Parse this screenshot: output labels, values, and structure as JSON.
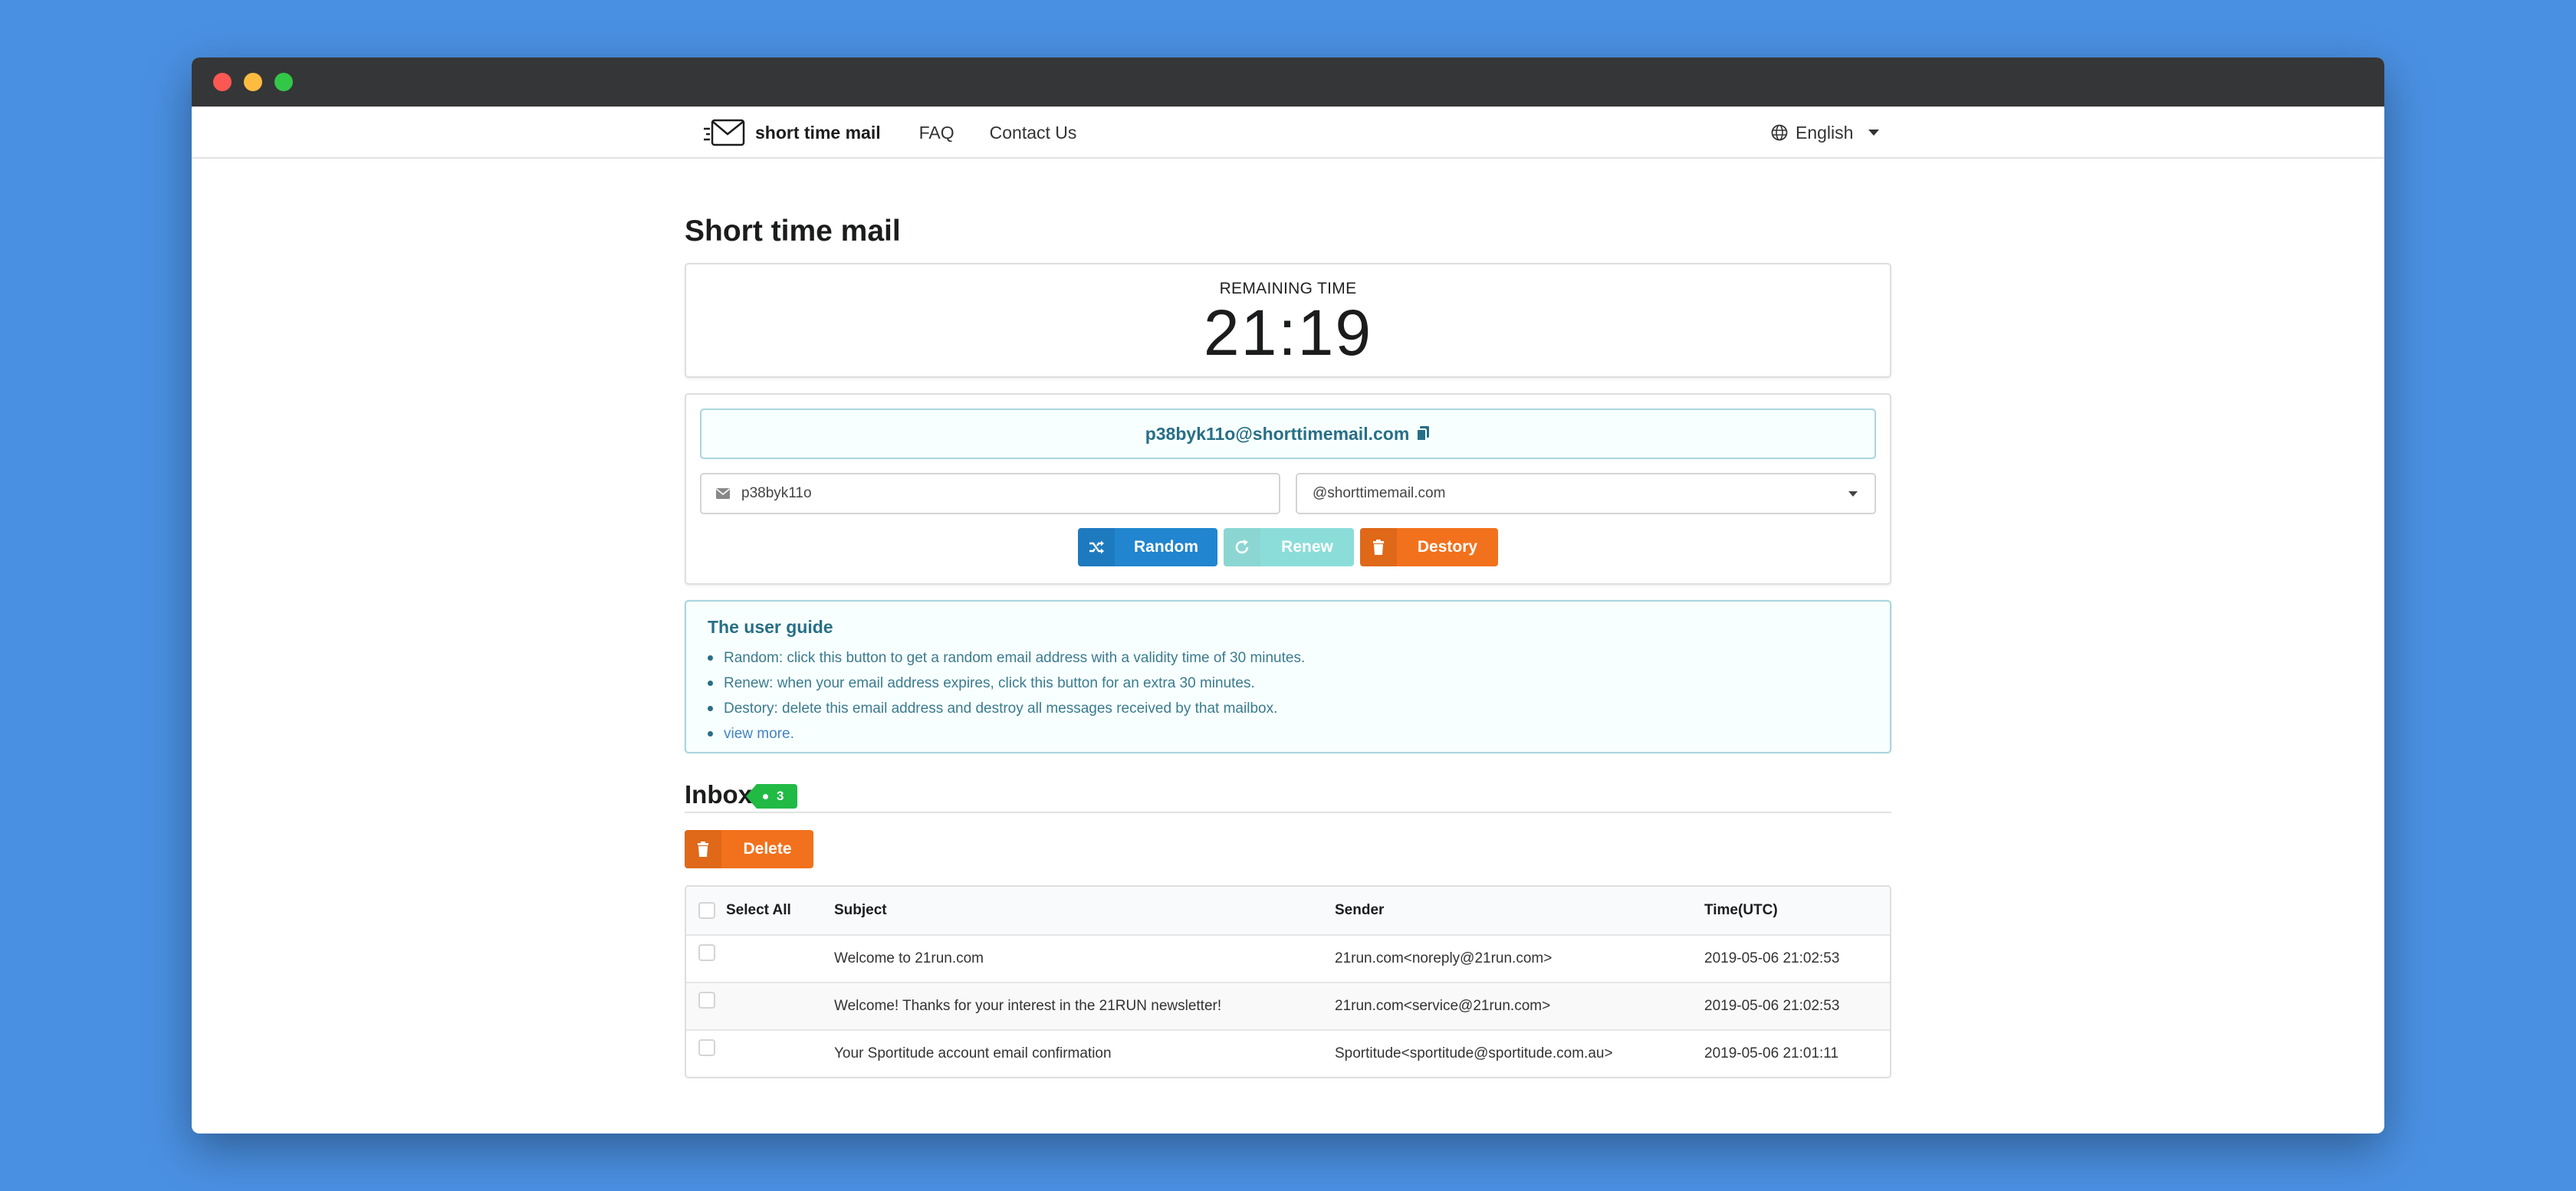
{
  "nav": {
    "brand": "short time mail",
    "links": [
      "FAQ",
      "Contact Us"
    ],
    "language": "English"
  },
  "page_title": "Short time mail",
  "timer": {
    "label": "REMAINING TIME",
    "value": "21:19"
  },
  "mailbox": {
    "address": "p38byk11o@shorttimemail.com",
    "username": "p38byk11o",
    "domain": "@shorttimemail.com",
    "buttons": {
      "random": "Random",
      "renew": "Renew",
      "destroy": "Destory"
    }
  },
  "guide": {
    "title": "The user guide",
    "items": [
      "Random: click this button to get a random email address with a validity time of 30 minutes.",
      "Renew: when your email address expires, click this button for an extra 30 minutes.",
      "Destory: delete this email address and destroy all messages received by that mailbox.",
      "view more."
    ]
  },
  "inbox": {
    "title": "Inbox",
    "count": "3",
    "delete_label": "Delete",
    "columns": [
      "Select All",
      "Subject",
      "Sender",
      "Time(UTC)"
    ],
    "rows": [
      {
        "subject": "Welcome to 21run.com",
        "sender": "21run.com<noreply@21run.com>",
        "time": "2019-05-06 21:02:53"
      },
      {
        "subject": "Welcome! Thanks for your interest in the 21RUN newsletter!",
        "sender": "21run.com<service@21run.com>",
        "time": "2019-05-06 21:02:53"
      },
      {
        "subject": "Your Sportitude account email confirmation",
        "sender": "Sportitude<sportitude@sportitude.com.au>",
        "time": "2019-05-06 21:01:11"
      }
    ]
  },
  "colors": {
    "background": "#4a90e2",
    "primary": "#2185d0",
    "teal": "#00b5ad",
    "orange": "#f2711c",
    "green": "#21ba45",
    "info": "#276f86"
  }
}
